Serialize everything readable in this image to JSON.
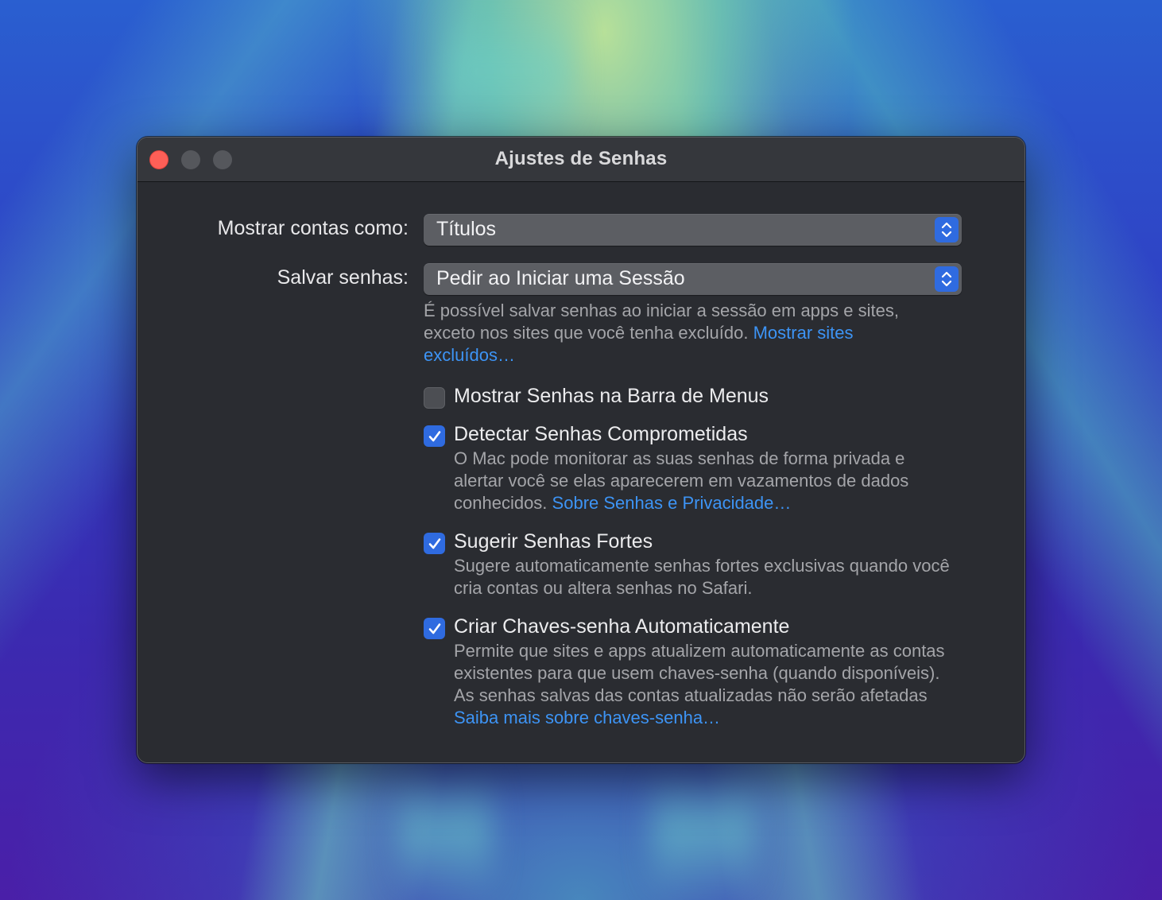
{
  "window": {
    "title": "Ajustes de Senhas"
  },
  "show_accounts": {
    "label": "Mostrar contas como:",
    "value": "Títulos"
  },
  "save_passwords": {
    "label": "Salvar senhas:",
    "value": "Pedir ao Iniciar uma Sessão",
    "help": "É possível salvar senhas ao iniciar a sessão em apps e sites, exceto nos sites que você tenha excluído.",
    "link": "Mostrar sites excluídos…"
  },
  "options": [
    {
      "label": "Mostrar Senhas na Barra de Menus",
      "checked": false,
      "help": "",
      "link": ""
    },
    {
      "label": "Detectar Senhas Comprometidas",
      "checked": true,
      "help": "O Mac pode monitorar as suas senhas de forma privada e alertar você se elas aparecerem em vazamentos de dados conhecidos.",
      "link": "Sobre Senhas e Privacidade…"
    },
    {
      "label": "Sugerir Senhas Fortes",
      "checked": true,
      "help": "Sugere automaticamente senhas fortes exclusivas quando você cria contas ou altera senhas no Safari.",
      "link": ""
    },
    {
      "label": "Criar Chaves-senha Automaticamente",
      "checked": true,
      "help": "Permite que sites e apps atualizem automaticamente as contas existentes para que usem chaves-senha (quando disponíveis). As senhas salvas das contas atualizadas não serão afetadas",
      "link": "Saiba mais sobre chaves-senha…"
    }
  ],
  "colors": {
    "accent": "#2f6be0",
    "link": "#3d94f5",
    "close": "#fe5f57"
  }
}
